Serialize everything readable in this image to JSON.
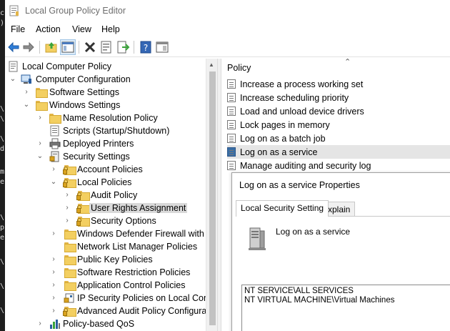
{
  "window": {
    "title": "Local Group Policy Editor"
  },
  "menu": [
    {
      "label": "File"
    },
    {
      "label": "Action"
    },
    {
      "label": "View"
    },
    {
      "label": "Help"
    }
  ],
  "toolbar": {
    "buttons": [
      {
        "icon": "back-arrow-icon"
      },
      {
        "icon": "forward-arrow-icon"
      },
      {
        "icon": "up-folder-icon"
      },
      {
        "icon": "show-hide-console-tree-icon"
      },
      {
        "icon": "delete-x-icon"
      },
      {
        "icon": "properties-sheet-icon"
      },
      {
        "icon": "export-list-icon"
      },
      {
        "icon": "help-icon"
      },
      {
        "icon": "show-hide-action-pane-icon"
      }
    ]
  },
  "tree": {
    "items": [
      {
        "label": "Local Computer Policy"
      },
      {
        "label": "Computer Configuration"
      },
      {
        "label": "Software Settings"
      },
      {
        "label": "Windows Settings"
      },
      {
        "label": "Name Resolution Policy"
      },
      {
        "label": "Scripts (Startup/Shutdown)"
      },
      {
        "label": "Deployed Printers"
      },
      {
        "label": "Security Settings"
      },
      {
        "label": "Account Policies"
      },
      {
        "label": "Local Policies"
      },
      {
        "label": "Audit Policy"
      },
      {
        "label": "User Rights Assignment"
      },
      {
        "label": "Security Options"
      },
      {
        "label": "Windows Defender Firewall with A"
      },
      {
        "label": "Network List Manager Policies"
      },
      {
        "label": "Public Key Policies"
      },
      {
        "label": "Software Restriction Policies"
      },
      {
        "label": "Application Control Policies"
      },
      {
        "label": "IP Security Policies on Local Comp"
      },
      {
        "label": "Advanced Audit Policy Configurat"
      },
      {
        "label": "Policy-based QoS"
      }
    ]
  },
  "policy_pane": {
    "header": "Policy",
    "items": [
      {
        "label": "Increase a process working set"
      },
      {
        "label": "Increase scheduling priority"
      },
      {
        "label": "Load and unload device drivers"
      },
      {
        "label": "Lock pages in memory"
      },
      {
        "label": "Log on as a batch job"
      },
      {
        "label": "Log on as a service"
      },
      {
        "label": "Manage auditing and security log"
      }
    ]
  },
  "dialog": {
    "title": "Log on as a service Properties",
    "tabs": [
      {
        "label": "Local Security Setting"
      },
      {
        "label": "Explain"
      }
    ],
    "policy_name": "Log on as a service",
    "members": [
      "NT SERVICE\\ALL SERVICES",
      "NT VIRTUAL MACHINE\\Virtual Machines"
    ]
  },
  "colors": {
    "folder": "#f3cf61",
    "selection": "#d9d9d9",
    "highlight_row": "#e5e5e5",
    "accent_blue": "#3a6ea5"
  }
}
